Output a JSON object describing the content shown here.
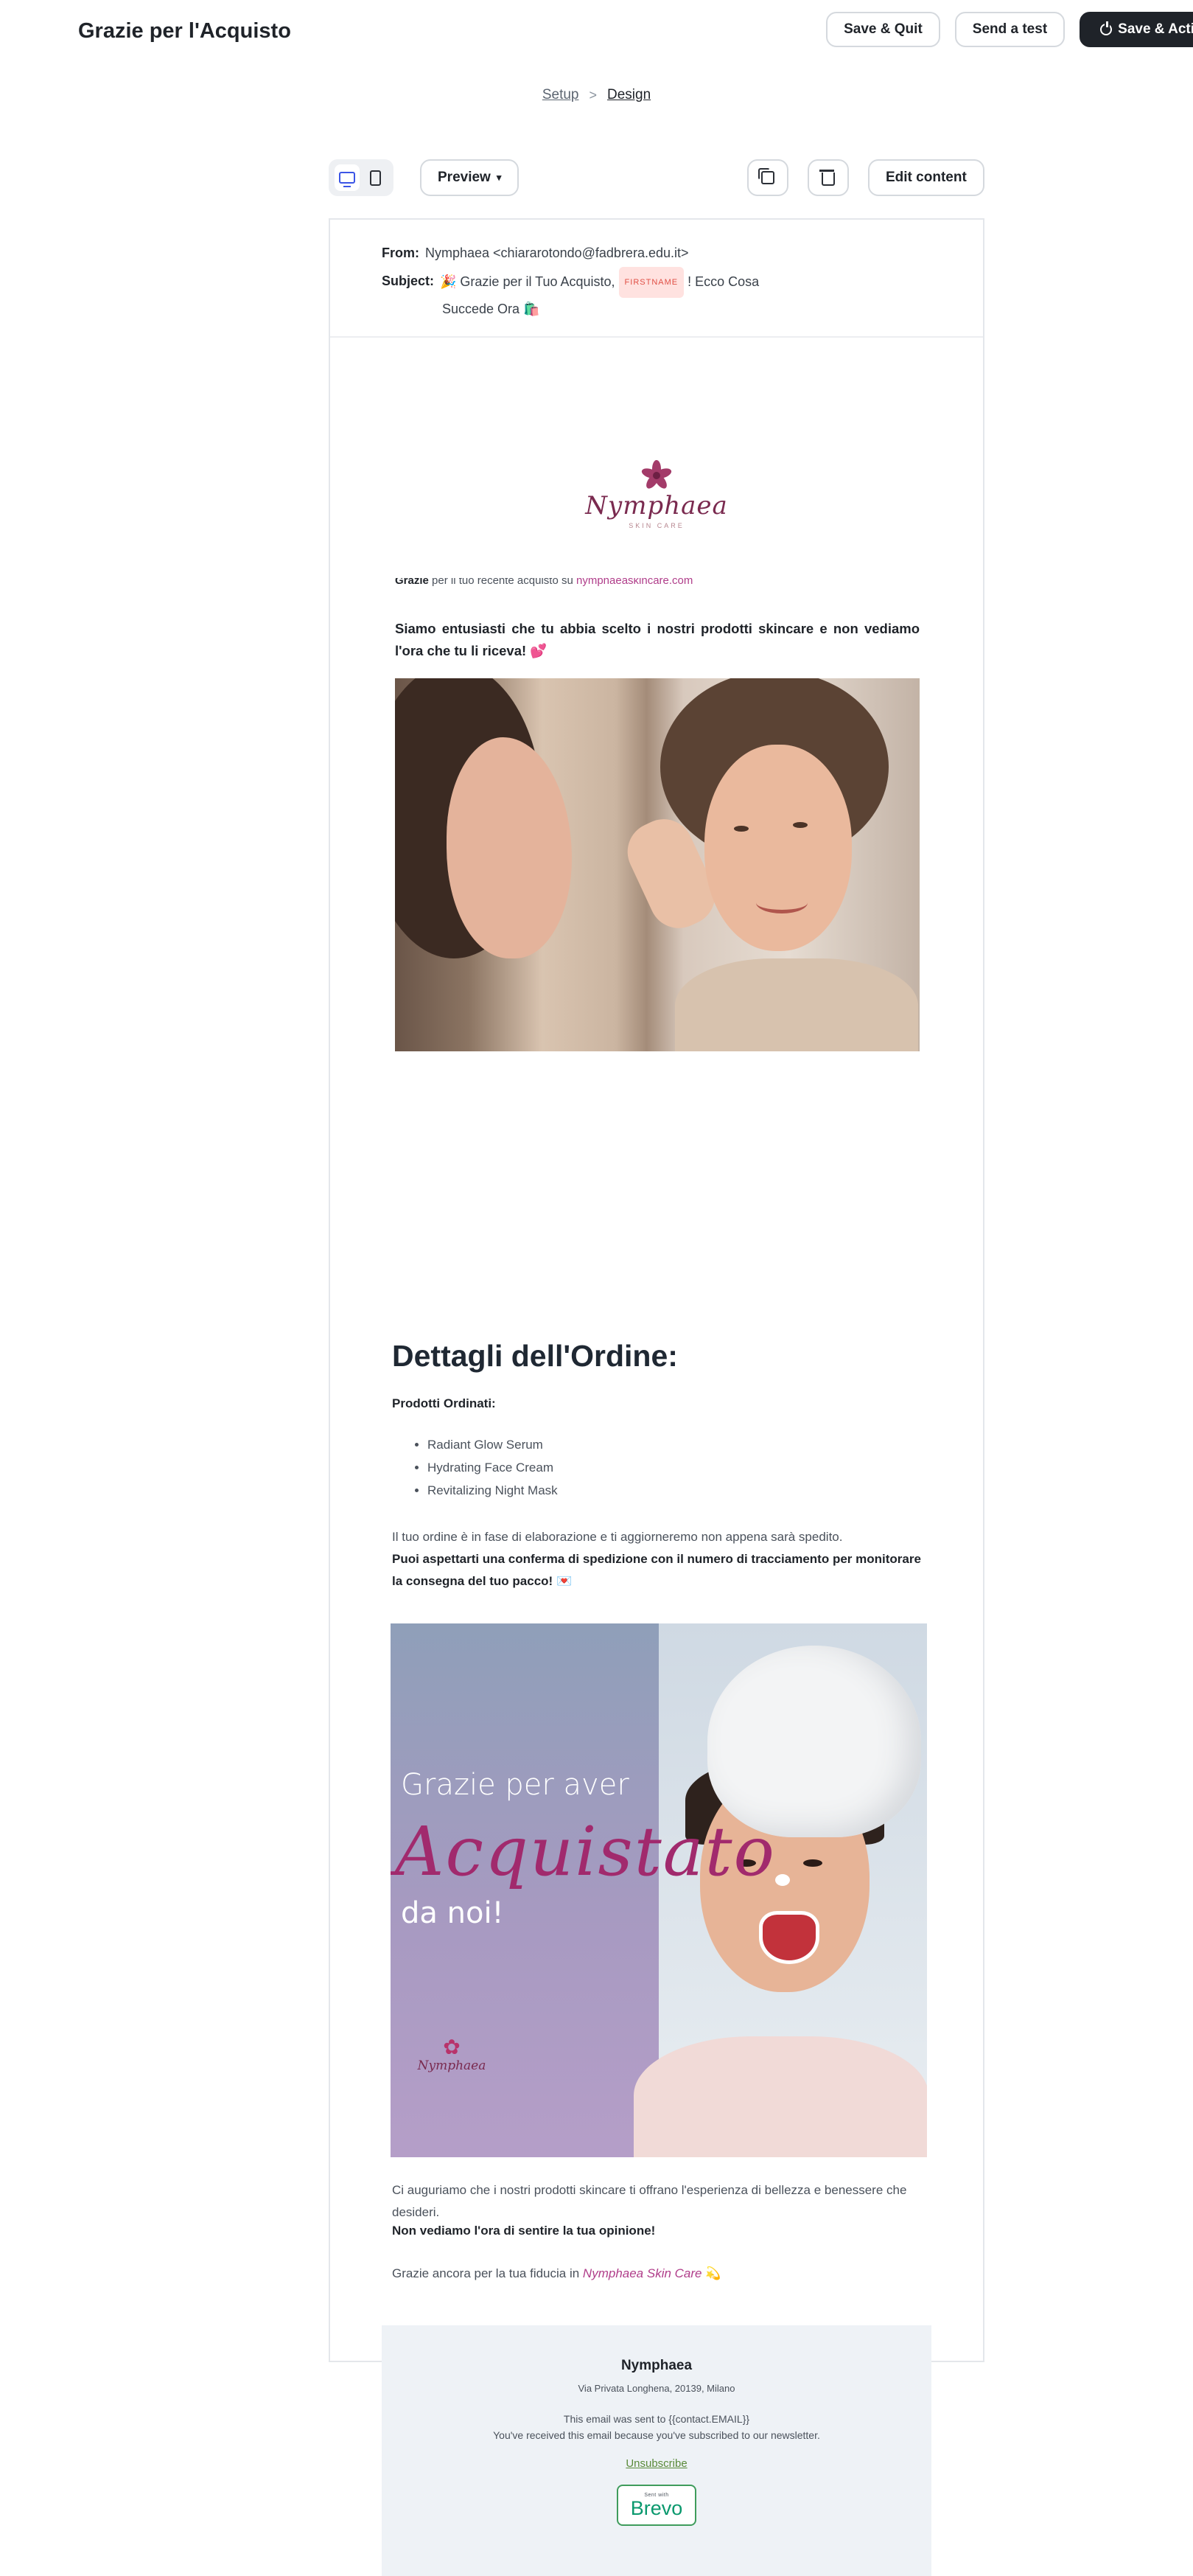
{
  "header": {
    "title": "Grazie per l'Acquisto",
    "save_quit": "Save & Quit",
    "send_test": "Send a test",
    "save_activate": "Save & Acti"
  },
  "breadcrumb": {
    "step1": "Setup",
    "separator": ">",
    "step2": "Design"
  },
  "toolbar": {
    "preview": "Preview",
    "caret": "▾",
    "edit_content": "Edit content"
  },
  "email_meta": {
    "from_label": "From:",
    "from_value": "Nymphaea <chiararotondo@fadbrera.edu.it>",
    "subject_label": "Subject:",
    "subject_part1": "🎉 Grazie per il Tuo Acquisto,",
    "subject_tag": "FIRSTNAME",
    "subject_part2": "! Ecco Cosa",
    "subject_part3": "Succede Ora 🛍️"
  },
  "logo": {
    "name": "Nymphaea",
    "tagline": "SKIN CARE"
  },
  "cut_line": {
    "bold": "Grazie",
    "text": " per il tuo recente acquisto su ",
    "link": "nymphaeaskincare.com"
  },
  "intro": {
    "text": "Siamo entusiasti che tu abbia scelto i nostri prodotti skincare e non vediamo l'ora che tu li riceva!",
    "emoji": "💕"
  },
  "order": {
    "heading": "Dettagli dell'Ordine:",
    "products_label": "Prodotti Ordinati:",
    "products": [
      "Radiant Glow Serum",
      "Hydrating Face Cream",
      "Revitalizing Night Mask"
    ],
    "status": "Il tuo ordine è in fase di elaborazione e ti aggiorneremo non appena sarà spedito.",
    "tracking": "Puoi aspettarti una conferma di spedizione con il numero di tracciamento per monitorare la consegna del tuo pacco!",
    "tracking_emoji": "💌"
  },
  "banner": {
    "line1": "Grazie per aver",
    "script": "Acquistato",
    "line2": "da noi!",
    "logo": "Nymphaea"
  },
  "closing": {
    "wish": "Ci auguriamo che i nostri prodotti skincare ti offrano l'esperienza di bellezza e benessere che desideri.",
    "opinion": "Non vediamo l'ora di sentire la tua opinione!",
    "thanks_prefix": "Grazie ancora per la tua fiducia in ",
    "brand": "Nymphaea Skin Care",
    "thanks_emoji": "💫"
  },
  "footer": {
    "company": "Nymphaea",
    "address": "Via Privata Longhena, 20139, Milano",
    "sent_to": "This email was sent to {{contact.EMAIL}}",
    "reason": "You've received this email because you've subscribed to our newsletter.",
    "unsubscribe": "Unsubscribe",
    "badge_small": "Sent with",
    "badge_brand": "Brevo"
  },
  "colors": {
    "accent": "#3b55e6",
    "brand": "#a33b69",
    "dark_button": "#1f2329"
  }
}
